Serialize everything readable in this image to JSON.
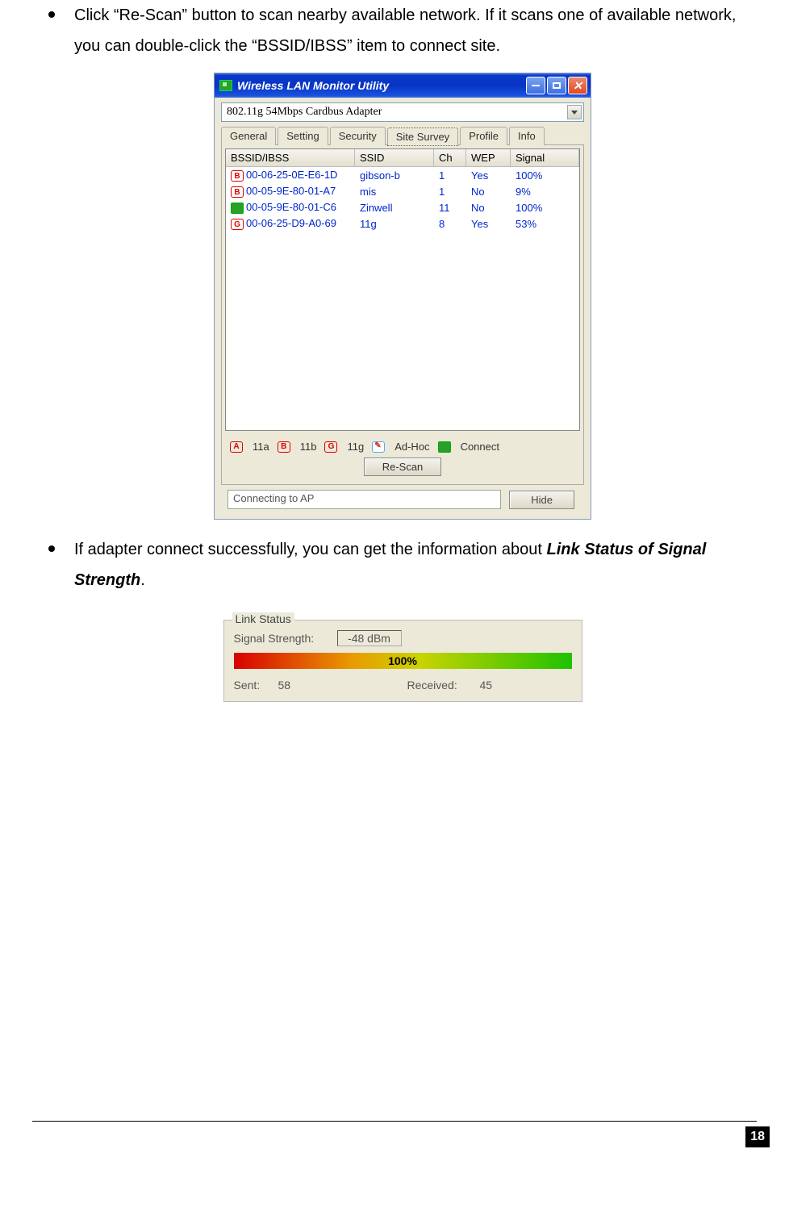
{
  "bullets": {
    "b1": "Click “Re-Scan” button to scan nearby available network. If it scans one of available network, you can double-click the “BSSID/IBSS” item to connect site.",
    "b2_part1": "If adapter connect successfully, you can get the information about ",
    "b2_bolditalic": "Link Status of Signal Strength",
    "b2_part2": "."
  },
  "window": {
    "title": "Wireless LAN Monitor Utility",
    "adapter": "802.11g 54Mbps Cardbus Adapter",
    "tabs": [
      "General",
      "Setting",
      "Security",
      "Site Survey",
      "Profile",
      "Info"
    ],
    "active_tab": 3,
    "columns": {
      "bssid": "BSSID/IBSS",
      "ssid": "SSID",
      "ch": "Ch",
      "wep": "WEP",
      "signal": "Signal"
    },
    "rows": [
      {
        "icon": "B",
        "bssid": "00-06-25-0E-E6-1D",
        "ssid": "gibson-b",
        "ch": "1",
        "wep": "Yes",
        "signal": "100%"
      },
      {
        "icon": "B",
        "bssid": "00-05-9E-80-01-A7",
        "ssid": "mis",
        "ch": "1",
        "wep": "No",
        "signal": "9%"
      },
      {
        "icon": "CONN",
        "bssid": "00-05-9E-80-01-C6",
        "ssid": "Zinwell",
        "ch": "11",
        "wep": "No",
        "signal": "100%"
      },
      {
        "icon": "G",
        "bssid": "00-06-25-D9-A0-69",
        "ssid": "11g",
        "ch": "8",
        "wep": "Yes",
        "signal": "53%"
      }
    ],
    "legend": {
      "a": "11a",
      "b": "11b",
      "g": "11g",
      "adhoc": "Ad-Hoc",
      "connect": "Connect"
    },
    "rescan": "Re-Scan",
    "status": "Connecting to AP",
    "hide": "Hide"
  },
  "linkstatus": {
    "legend": "Link Status",
    "signal_label": "Signal Strength:",
    "signal_value": "-48 dBm",
    "percent": "100%",
    "sent_label": "Sent:",
    "sent_value": "58",
    "recv_label": "Received:",
    "recv_value": "45"
  },
  "page_number": "18",
  "chart_data": {
    "type": "bar",
    "title": "Link Status signal strength",
    "categories": [
      "Signal Strength"
    ],
    "values": [
      100
    ],
    "ylim": [
      0,
      100
    ],
    "ylabel": "%"
  }
}
